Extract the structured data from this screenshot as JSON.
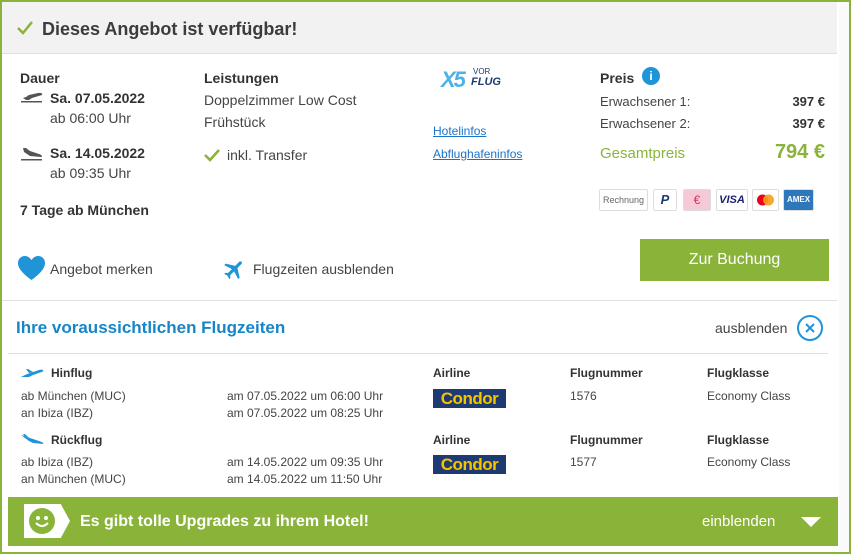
{
  "header": {
    "title": "Dieses Angebot ist verfügbar!"
  },
  "details": {
    "duration_label": "Dauer",
    "outbound_date": "Sa. 07.05.2022",
    "outbound_time": "ab 06:00 Uhr",
    "return_date": "Sa. 14.05.2022",
    "return_time": "ab 09:35 Uhr",
    "summary": "7 Tage ab München"
  },
  "services": {
    "label": "Leistungen",
    "room": "Doppelzimmer Low Cost",
    "board": "Frühstück",
    "transfer": "inkl. Transfer"
  },
  "operator": {
    "logo_text_1": "X5",
    "logo_text_2": "VOR",
    "logo_text_3": "FLUG",
    "hotel_info_link": "Hotelinfos",
    "airport_info_link": "Abflughafeninfos"
  },
  "price": {
    "label": "Preis",
    "info_icon": "info-icon",
    "adult1_label": "Erwachsener 1:",
    "adult1_value": "397 €",
    "adult2_label": "Erwachsener 2:",
    "adult2_value": "397 €",
    "total_label": "Gesamtpreis",
    "total_value": "794 €"
  },
  "payment_methods": [
    "Rechnung",
    "P",
    "€",
    "VISA",
    "mastercard",
    "AMEX"
  ],
  "actions": {
    "remember": "Angebot merken",
    "hide_flights": "Flugzeiten ausblenden",
    "book": "Zur Buchung"
  },
  "flights": {
    "title": "Ihre voraussichtlichen Flugzeiten",
    "hide": "ausblenden",
    "col_airline": "Airline",
    "col_flightno": "Flugnummer",
    "col_class": "Flugklasse",
    "outbound": {
      "label": "Hinflug",
      "from": "ab München (MUC)",
      "to": "an Ibiza (IBZ)",
      "dep": "am 07.05.2022 um 06:00 Uhr",
      "arr": "am 07.05.2022 um 08:25 Uhr",
      "airline": "Condor",
      "flightno": "1576",
      "class": "Economy Class"
    },
    "return": {
      "label": "Rückflug",
      "from": "ab Ibiza (IBZ)",
      "to": "an München (MUC)",
      "dep": "am 14.05.2022 um 09:35 Uhr",
      "arr": "am 14.05.2022 um 11:50 Uhr",
      "airline": "Condor",
      "flightno": "1577",
      "class": "Economy Class"
    }
  },
  "upgrade": {
    "message": "Es gibt tolle Upgrades zu ihrem Hotel!",
    "show": "einblenden"
  },
  "colors": {
    "accent_green": "#8ab33a",
    "accent_blue": "#1785c6",
    "link_blue": "#1a73c8",
    "condor_navy": "#1e3a72",
    "condor_yellow": "#f5c400"
  }
}
